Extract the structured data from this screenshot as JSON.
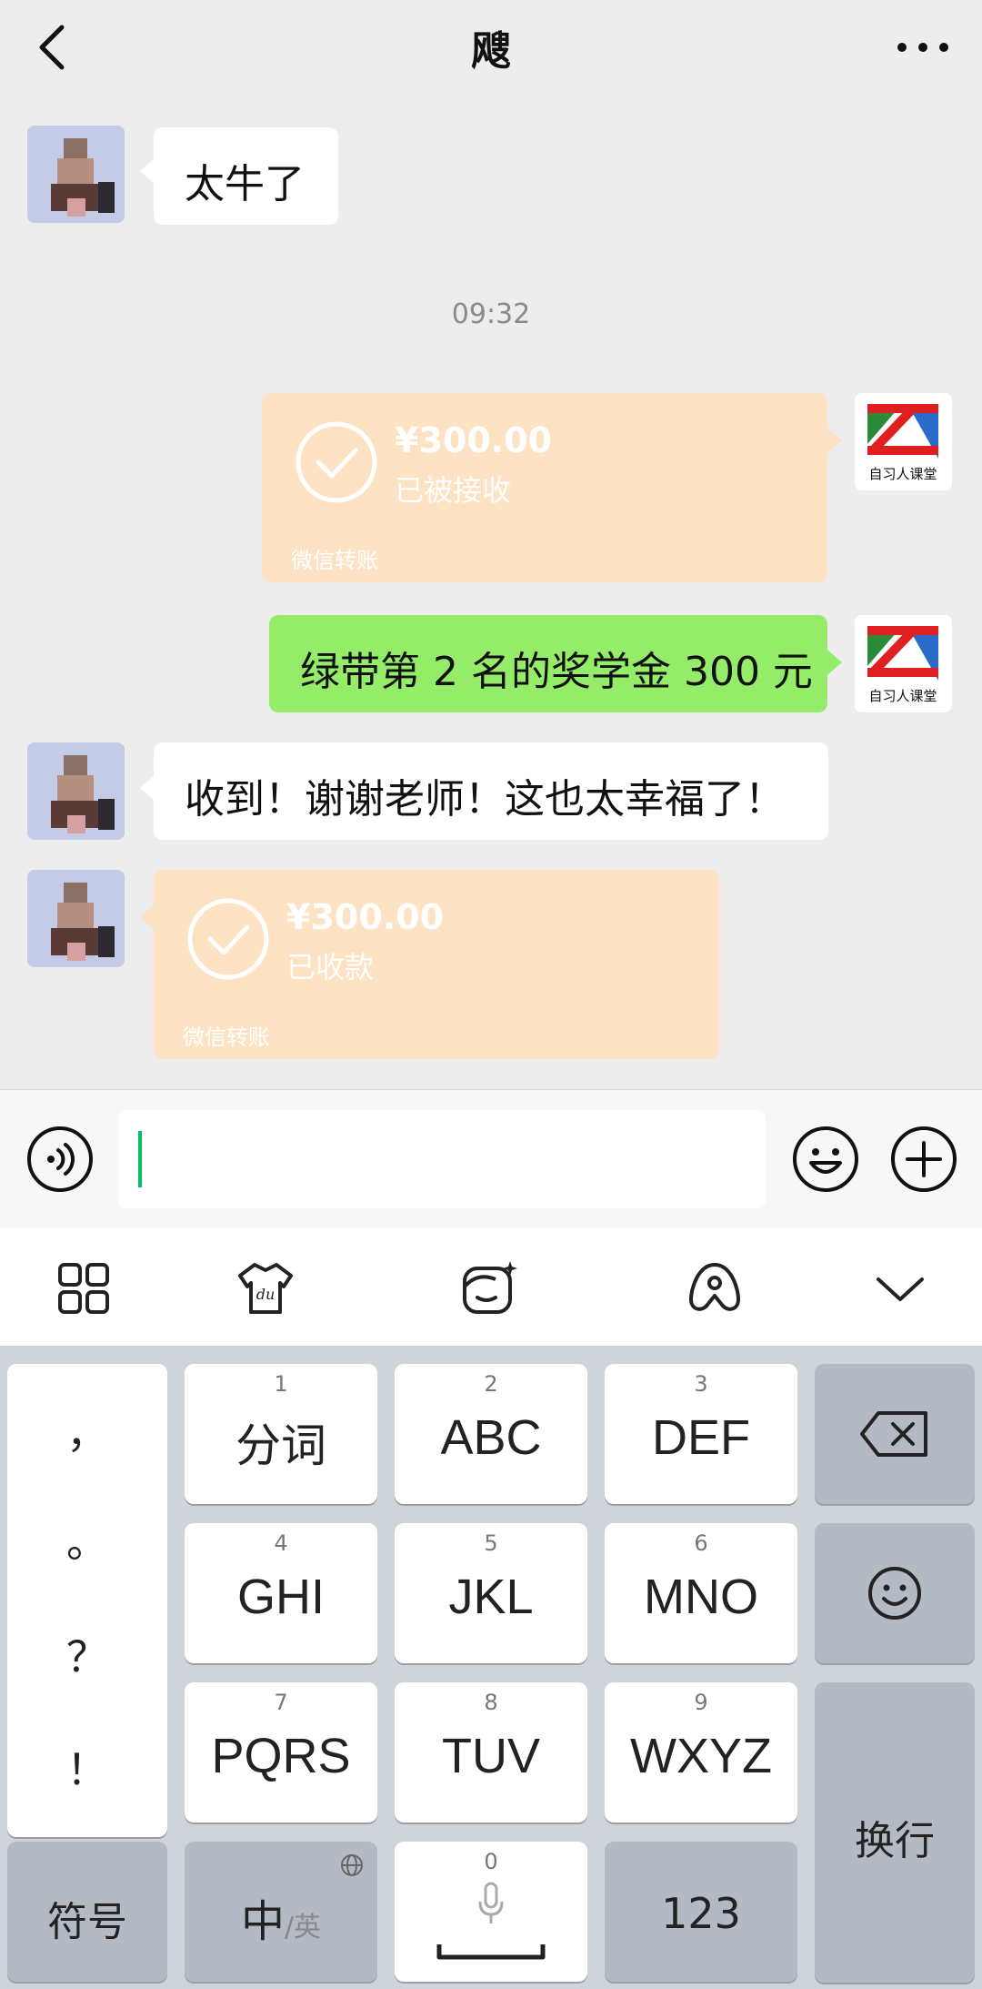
{
  "header": {
    "title": "飕"
  },
  "chat": {
    "messages": [
      {
        "sender": "contact",
        "type": "text",
        "text": "太牛了"
      },
      {
        "type": "time",
        "text": "09:32"
      },
      {
        "sender": "me",
        "type": "transfer",
        "amount": "¥300.00",
        "status": "已被接收",
        "footer": "微信转账"
      },
      {
        "sender": "me",
        "type": "text",
        "text": "绿带第 2 名的奖学金 300 元"
      },
      {
        "sender": "contact",
        "type": "text",
        "text": "收到！谢谢老师！这也太幸福了！"
      },
      {
        "sender": "contact",
        "type": "transfer",
        "amount": "¥300.00",
        "status": "已收款",
        "footer": "微信转账"
      }
    ],
    "my_avatar_text": "自习人课堂"
  },
  "input": {
    "value": ""
  },
  "keyboard": {
    "punctuation": [
      "，",
      "。",
      "？",
      "！"
    ],
    "keys": [
      {
        "num": "1",
        "label": "分词"
      },
      {
        "num": "2",
        "label": "ABC"
      },
      {
        "num": "3",
        "label": "DEF"
      },
      {
        "num": "4",
        "label": "GHI"
      },
      {
        "num": "5",
        "label": "JKL"
      },
      {
        "num": "6",
        "label": "MNO"
      },
      {
        "num": "7",
        "label": "PQRS"
      },
      {
        "num": "8",
        "label": "TUV"
      },
      {
        "num": "9",
        "label": "WXYZ"
      }
    ],
    "symbol_label": "符号",
    "lang_label_main": "中",
    "lang_label_sub": "/英",
    "space_num": "0",
    "numbers_label": "123",
    "enter_label": "换行"
  },
  "colors": {
    "green_bubble": "#95ec69",
    "transfer_bg": "#fde2c3",
    "cursor": "#07c160",
    "keyboard_bg": "#cfd3da"
  }
}
